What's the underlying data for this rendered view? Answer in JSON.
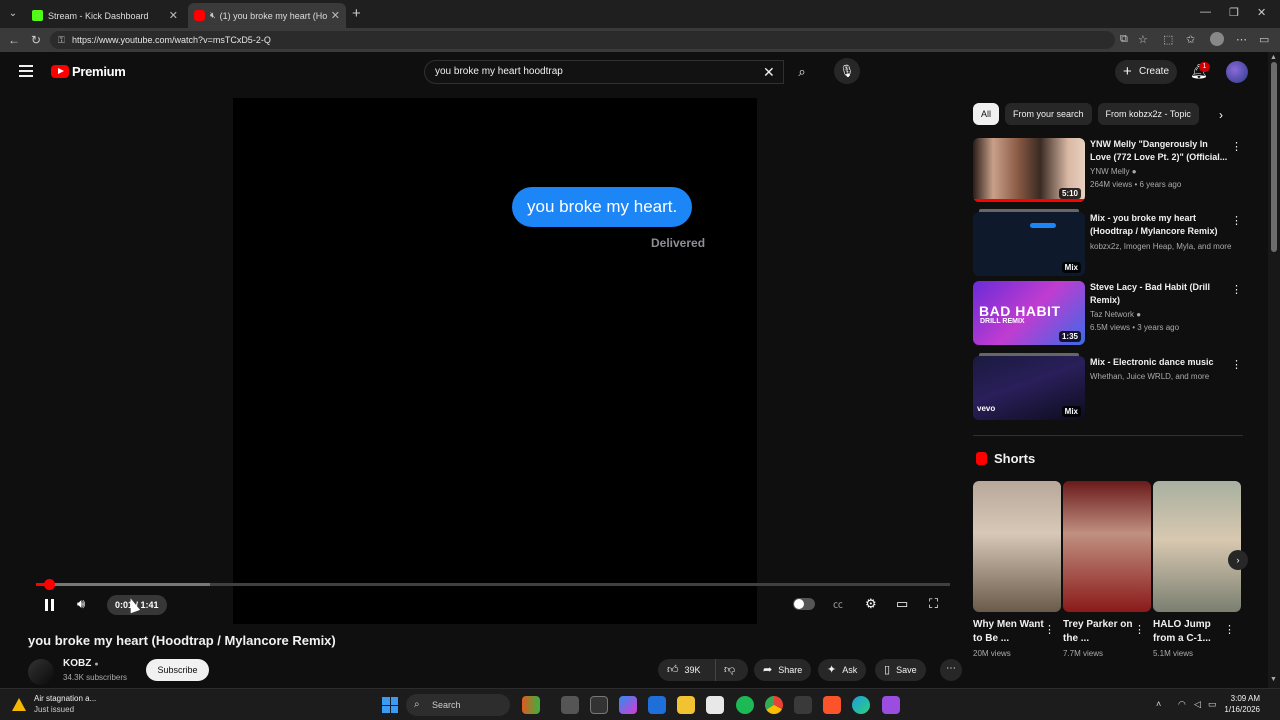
{
  "browser": {
    "tabs": [
      {
        "label": "Stream - Kick Dashboard",
        "icon": "kick-icon",
        "color": "#53fc18"
      },
      {
        "label": "(1) you broke my heart (Hoo",
        "icon": "youtube-icon",
        "color": "#ff0000",
        "active": true
      }
    ],
    "url": "https://www.youtube.com/watch?v=msTCxD5-2-Q"
  },
  "header": {
    "logo_text": "Premium",
    "search_query": "you broke my heart hoodtrap",
    "create_label": "Create",
    "notification_count": "1"
  },
  "player": {
    "message_text": "you broke my heart.",
    "status_text": "Delivered",
    "time_current": "0:01",
    "time_total": "1:41",
    "time_display": "0:01 / 1:41",
    "progress_fraction": 0.0099,
    "buffer_fraction": 0.19,
    "autoplay": true
  },
  "video": {
    "title": "you broke my heart (Hoodtrap / Mylancore Remix)",
    "channel": "KOBZ",
    "subscribers": "34.3K subscribers",
    "subscribe_label": "Subscribe",
    "like_count": "39K",
    "share_label": "Share",
    "ask_label": "Ask",
    "save_label": "Save"
  },
  "sidebar": {
    "chips": [
      "All",
      "From your search",
      "From kobzx2z - Topic"
    ],
    "recommendations": [
      {
        "title": "YNW Melly \"Dangerously In Love (772 Love Pt. 2)\" (Official...",
        "channel": "YNW Melly",
        "verified": true,
        "meta": "264M views • 6 years ago",
        "badge": "5:10"
      },
      {
        "title": "Mix - you broke my heart (Hoodtrap / Mylancore Remix)",
        "channel": "kobzx2z, Imogen Heap, Myla, and more",
        "verified": false,
        "meta": "",
        "badge": "Mix"
      },
      {
        "title": "Steve Lacy - Bad Habit (Drill Remix)",
        "channel": "Taz Network",
        "verified": true,
        "meta": "6.5M views • 3 years ago",
        "badge": "1:35"
      },
      {
        "title": "Mix - Electronic dance music",
        "channel": "Whethan, Juice WRLD, and more",
        "verified": false,
        "meta": "",
        "badge": "Mix"
      }
    ],
    "thumb_texts": {
      "bad_habit_top": "BAD HABIT",
      "bad_habit_bottom": "DRILL REMIX",
      "vevo": "vevo"
    },
    "shorts_title": "Shorts",
    "shorts": [
      {
        "title": "Why Men Want to Be ...",
        "views": "20M views"
      },
      {
        "title": "Trey Parker on the ...",
        "views": "7.7M views"
      },
      {
        "title": "HALO Jump from a C-1...",
        "views": "5.1M views"
      }
    ]
  },
  "taskbar": {
    "weather_title": "Air stagnation a...",
    "weather_sub": "Just issued",
    "search_label": "Search",
    "time": "3:09 AM",
    "date": "1/16/2026"
  }
}
